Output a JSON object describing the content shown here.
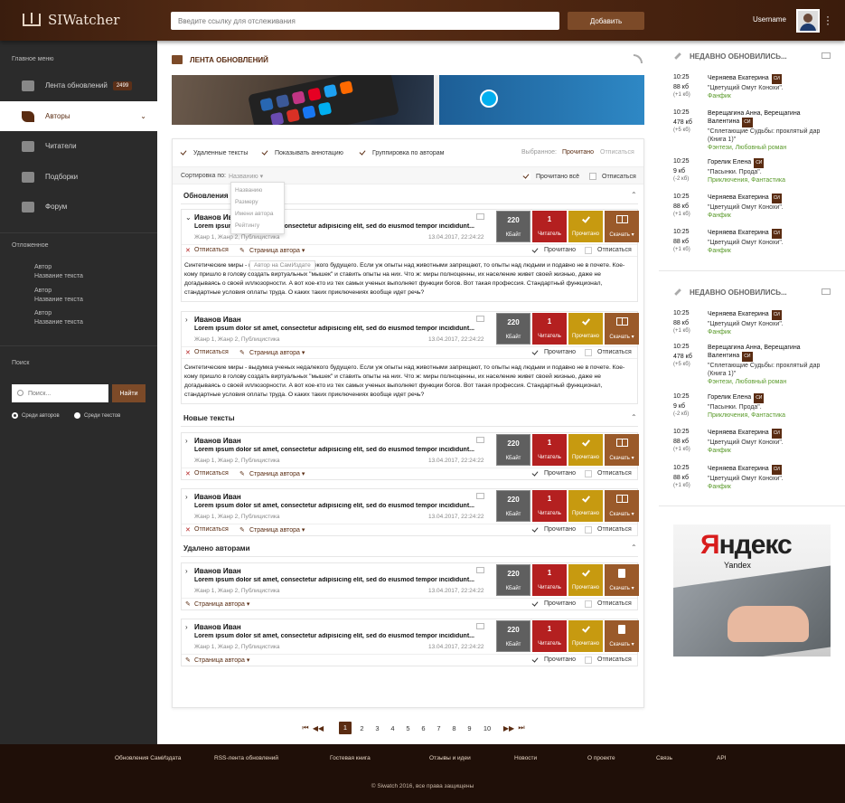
{
  "header": {
    "logo": "SIWatcher",
    "url_placeholder": "Введите ссылку для отслеживания",
    "add_label": "Добавить",
    "username": "Username"
  },
  "sidebar": {
    "main_menu_title": "Главное меню",
    "items": [
      {
        "label": "Лента обновлений",
        "badge": "2499",
        "icon": "feed-icon"
      },
      {
        "label": "Авторы",
        "icon": "feather-icon"
      },
      {
        "label": "Читатели",
        "icon": "book-icon"
      },
      {
        "label": "Подборки",
        "icon": "books-icon"
      },
      {
        "label": "Форум",
        "icon": "chat-icon"
      }
    ],
    "deferred_title": "Отложенное",
    "deferred": [
      {
        "author": "Автор",
        "title": "Название текста"
      },
      {
        "author": "Автор",
        "title": "Название текста"
      },
      {
        "author": "Автор",
        "title": "Название текста"
      }
    ],
    "search_title": "Поиск",
    "search_placeholder": "Поиск...",
    "search_button": "Найти",
    "radio_authors": "Среди авторов",
    "radio_texts": "Среди текстов"
  },
  "main": {
    "title": "ЛЕНТА ОБНОВЛЕНИЙ",
    "options": {
      "deleted": "Удаленные тексты",
      "annotation": "Показывать аннотацию",
      "group": "Группировка по авторам",
      "selected_label": "Выбранное:",
      "selected_read": "Прочитано",
      "selected_unsub": "Отписаться"
    },
    "sort": {
      "label": "Сортировка по:",
      "value": "Названию",
      "options": [
        "Названию",
        "Размеру",
        "Имени автора",
        "Рейтингу"
      ],
      "read_all": "Прочитано всё",
      "unsubscribe": "Отписаться"
    },
    "tooltip": "Автор на СамИздате",
    "groups": [
      "Обновления",
      "Новые тексты",
      "Удалено авторами"
    ],
    "card": {
      "author": "Иванов Иван",
      "text": "Lorem ipsum dolor sit amet, consectetur adipisicing elit, sed do eiusmod tempor incididunt...",
      "genre": "Жанр 1, Жанр 2, Публицистика",
      "date": "13.04.2017, 22:24:22",
      "size_value": "220",
      "size_unit": "КБайт",
      "read_count": "1",
      "read_label": "Читатель",
      "done_label": "Прочитано",
      "dl_label": "Скачать ▾",
      "unsubscribe": "Отписаться",
      "author_page": "Страница автора",
      "read_cb": "Прочитано",
      "unsub_cb": "Отписаться",
      "annotation": "Синтетические миры - выдумка ученых недалекого будущего. Если уж опыты над животными запрещают, то опыты над людьми и подавно не в почете. Кое-кому пришло в голову создать виртуальных \"мышек\" и ставить опыты на них. Что ж: миры полноценны, их население живет своей жизнью, даже не догадываясь о своей иллюзорности. А вот кое-кто из тех самых ученых выполняет функции богов. Вот такая профессия. Стандартный функционал, стандартные условия оплаты труда. О каких таких приключениях вообще идет речь?"
    },
    "pagination": [
      "1",
      "2",
      "3",
      "4",
      "5",
      "6",
      "7",
      "8",
      "9",
      "10"
    ]
  },
  "right": {
    "heading": "НЕДАВНО ОБНОВИЛИСЬ...",
    "si_badge": "СИ",
    "entries": [
      {
        "time": "10:25",
        "size": "88 кб",
        "delta": "(+1 кб)",
        "author": "Черняева Екатерина",
        "title": "\"Цветущий Омут Конохи\".",
        "genre": "Фанфик"
      },
      {
        "time": "10:25",
        "size": "478 кб",
        "delta": "(+5 кб)",
        "author": "Верещагина Анна, Верещагина Валентина",
        "title": "\"Сплетающие Судьбы: проклятый дар (Книга 1)\"",
        "genre": "Фэнтези, Любовный роман"
      },
      {
        "time": "10:25",
        "size": "9 кб",
        "delta": "(-2 кб)",
        "author": "Горелик Елена",
        "title": "\"Пасынки. Прода\".",
        "genre": "Приключения, Фантастика"
      },
      {
        "time": "10:25",
        "size": "88 кб",
        "delta": "(+1 кб)",
        "author": "Черняева Екатерина",
        "title": "\"Цветущий Омут Конохи\".",
        "genre": "Фанфик"
      },
      {
        "time": "10:25",
        "size": "88 кб",
        "delta": "(+1 кб)",
        "author": "Черняева Екатерина",
        "title": "\"Цветущий Омут Конохи\".",
        "genre": "Фанфик"
      }
    ],
    "ad": {
      "logo_first": "Я",
      "logo_rest": "ндекс",
      "sub": "Yandex"
    }
  },
  "footer": {
    "links": [
      "Обновления СамИздата",
      "RSS-лента обновлений",
      "Гостевая книга",
      "Отзывы и идеи",
      "Новости",
      "О проекте",
      "Связь",
      "API"
    ],
    "copyright": "© Siwatch 2016, все права защищены"
  }
}
